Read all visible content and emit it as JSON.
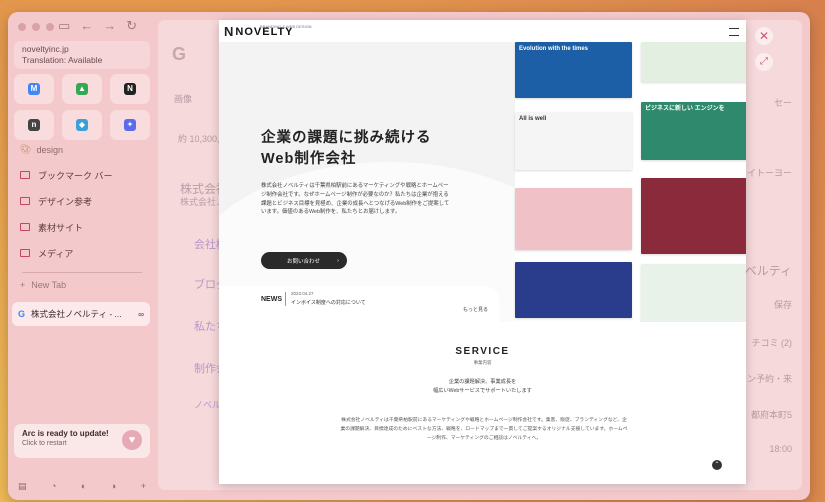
{
  "sidebar": {
    "url_line1": "noveltyinc.jp",
    "url_line2": "Translation: Available",
    "favorites": [
      {
        "icon": "gmail-icon",
        "color": "#4285f4",
        "glyph": "M"
      },
      {
        "icon": "google-drive-icon",
        "color": "#34a853",
        "glyph": "▲"
      },
      {
        "icon": "notion-icon",
        "color": "#222222",
        "glyph": "N"
      },
      {
        "icon": "notion-alt-icon",
        "color": "#444444",
        "glyph": "n"
      },
      {
        "icon": "maps-icon",
        "color": "#3aa0d8",
        "glyph": "◆"
      },
      {
        "icon": "ai-sparkle-icon",
        "color": "#5b6bf0",
        "glyph": "✦"
      }
    ],
    "space_label": "design",
    "folders": [
      "ブックマーク バー",
      "デザイン参考",
      "素材サイト",
      "メディア"
    ],
    "new_tab": "New Tab",
    "active_tab": "株式会社ノベルティ - ...",
    "update_title": "Arc is ready to update!",
    "update_sub": "Click to restart"
  },
  "background_page": {
    "result_count": "約 10,300,0",
    "items": [
      "株式会社",
      "株式会社ノ",
      "会社概",
      "ブログ",
      "私たち",
      "制作会",
      "ノベルティ"
    ],
    "right_labels": [
      "セー",
      "イトーヨー",
      "ベルティ",
      "保存",
      "チコミ (2)",
      "イン予約・来",
      "都府本町5",
      "18:00"
    ]
  },
  "modal": {
    "brand_name": "NOVELTY",
    "brand_tagline": "BRANDING & WEB DESIGN",
    "hero_title_1": "企業の課題に挑み続ける",
    "hero_title_2": "Web制作会社",
    "hero_body": "株式会社ノベルティは千葉県柏駅前にあるマーケティングや戦略とホームページ制作会社です。なぜホームページ制作が必要なのか？私たちは企業が抱える課題とビジネス目標を見極め、企業の成長へとつなげるWeb制作をご提案しています。価値のあるWeb制作を、私たちとお届けします。",
    "hero_button": "お問い合わせ",
    "news_label": "NEWS",
    "news_date": "2023.04.27",
    "news_text": "インボイス制度への対応について",
    "news_more": "もっと見る",
    "shots": [
      {
        "text": "Evolution with the times",
        "color": "#1c5fa6"
      },
      {
        "text": "",
        "color": "#e3efe0"
      },
      {
        "text": "All is well",
        "color": "#f5f5f5"
      },
      {
        "text": "ビジネスに新しい エンジンを",
        "color": "#2f8a6d"
      },
      {
        "text": "",
        "color": "#f0c2c8"
      },
      {
        "text": "",
        "color": "#8b2a3a"
      },
      {
        "text": "",
        "color": "#2a3c8c"
      },
      {
        "text": "",
        "color": "#e9f2e8"
      }
    ],
    "service_title": "SERVICE",
    "service_sub": "事業内容",
    "service_lead_1": "企業の課題解決、事業成長を",
    "service_lead_2": "幅広いWebサービスでサポートいたします",
    "service_body": "株式会社ノベルティは千葉県柏駅前にあるマーケティングや戦略とホームページ制作会社です。集客、販促、ブランディングなど、企業の課題解決、目標達成のためにベストな方法、戦略を、ロードマップまで一貫してご提案するオリジナル支援しています。ホームページ制作、マーケティングのご相談はノベルティへ。"
  }
}
